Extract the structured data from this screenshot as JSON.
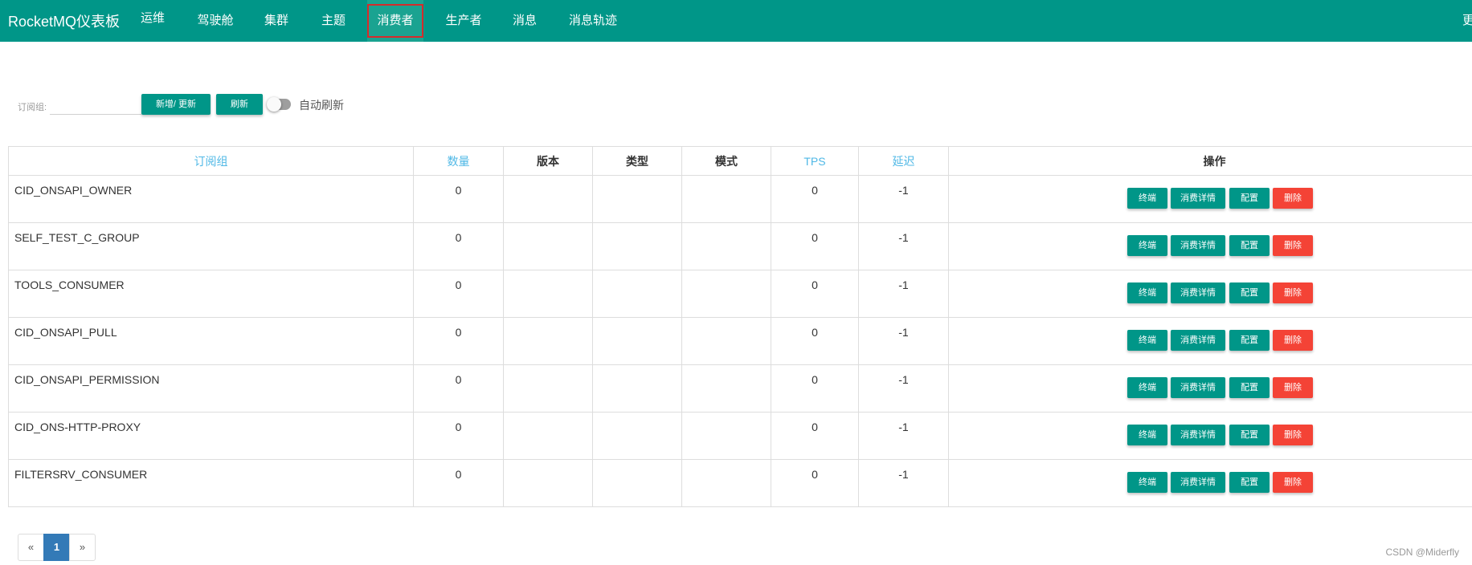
{
  "app": {
    "title": "RocketMQ仪表板"
  },
  "nav": {
    "items": [
      {
        "label": "运维"
      },
      {
        "label": "驾驶舱"
      },
      {
        "label": "集群"
      },
      {
        "label": "主题"
      },
      {
        "label": "消费者",
        "active": true
      },
      {
        "label": "生产者"
      },
      {
        "label": "消息"
      },
      {
        "label": "消息轨迹"
      }
    ],
    "more_label": "更"
  },
  "toolbar": {
    "group_label": "订阅组:",
    "group_value": "",
    "add_update_label": "新增/ 更新",
    "refresh_label": "刷新",
    "auto_refresh_label": "自动刷新",
    "auto_refresh_on": false
  },
  "table": {
    "headers": {
      "group": "订阅组",
      "count": "数量",
      "version": "版本",
      "type": "类型",
      "mode": "模式",
      "tps": "TPS",
      "delay": "延迟",
      "ops": "操作"
    },
    "rows": [
      {
        "group": "CID_ONSAPI_OWNER",
        "count": "0",
        "version": "",
        "type": "",
        "mode": "",
        "tps": "0",
        "delay": "-1"
      },
      {
        "group": "SELF_TEST_C_GROUP",
        "count": "0",
        "version": "",
        "type": "",
        "mode": "",
        "tps": "0",
        "delay": "-1"
      },
      {
        "group": "TOOLS_CONSUMER",
        "count": "0",
        "version": "",
        "type": "",
        "mode": "",
        "tps": "0",
        "delay": "-1"
      },
      {
        "group": "CID_ONSAPI_PULL",
        "count": "0",
        "version": "",
        "type": "",
        "mode": "",
        "tps": "0",
        "delay": "-1"
      },
      {
        "group": "CID_ONSAPI_PERMISSION",
        "count": "0",
        "version": "",
        "type": "",
        "mode": "",
        "tps": "0",
        "delay": "-1"
      },
      {
        "group": "CID_ONS-HTTP-PROXY",
        "count": "0",
        "version": "",
        "type": "",
        "mode": "",
        "tps": "0",
        "delay": "-1"
      },
      {
        "group": "FILTERSRV_CONSUMER",
        "count": "0",
        "version": "",
        "type": "",
        "mode": "",
        "tps": "0",
        "delay": "-1"
      }
    ],
    "actions": {
      "terminal": "终端",
      "detail": "消费详情",
      "config": "配置",
      "delete": "删除"
    }
  },
  "pagination": {
    "prev": "«",
    "current": "1",
    "next": "»"
  },
  "watermark": "CSDN @Miderfly",
  "colors": {
    "primary": "#009688",
    "danger": "#f44336",
    "link_header": "#4fb8e6",
    "pager_active": "#337ab7",
    "highlight_box": "#d62b2b"
  }
}
